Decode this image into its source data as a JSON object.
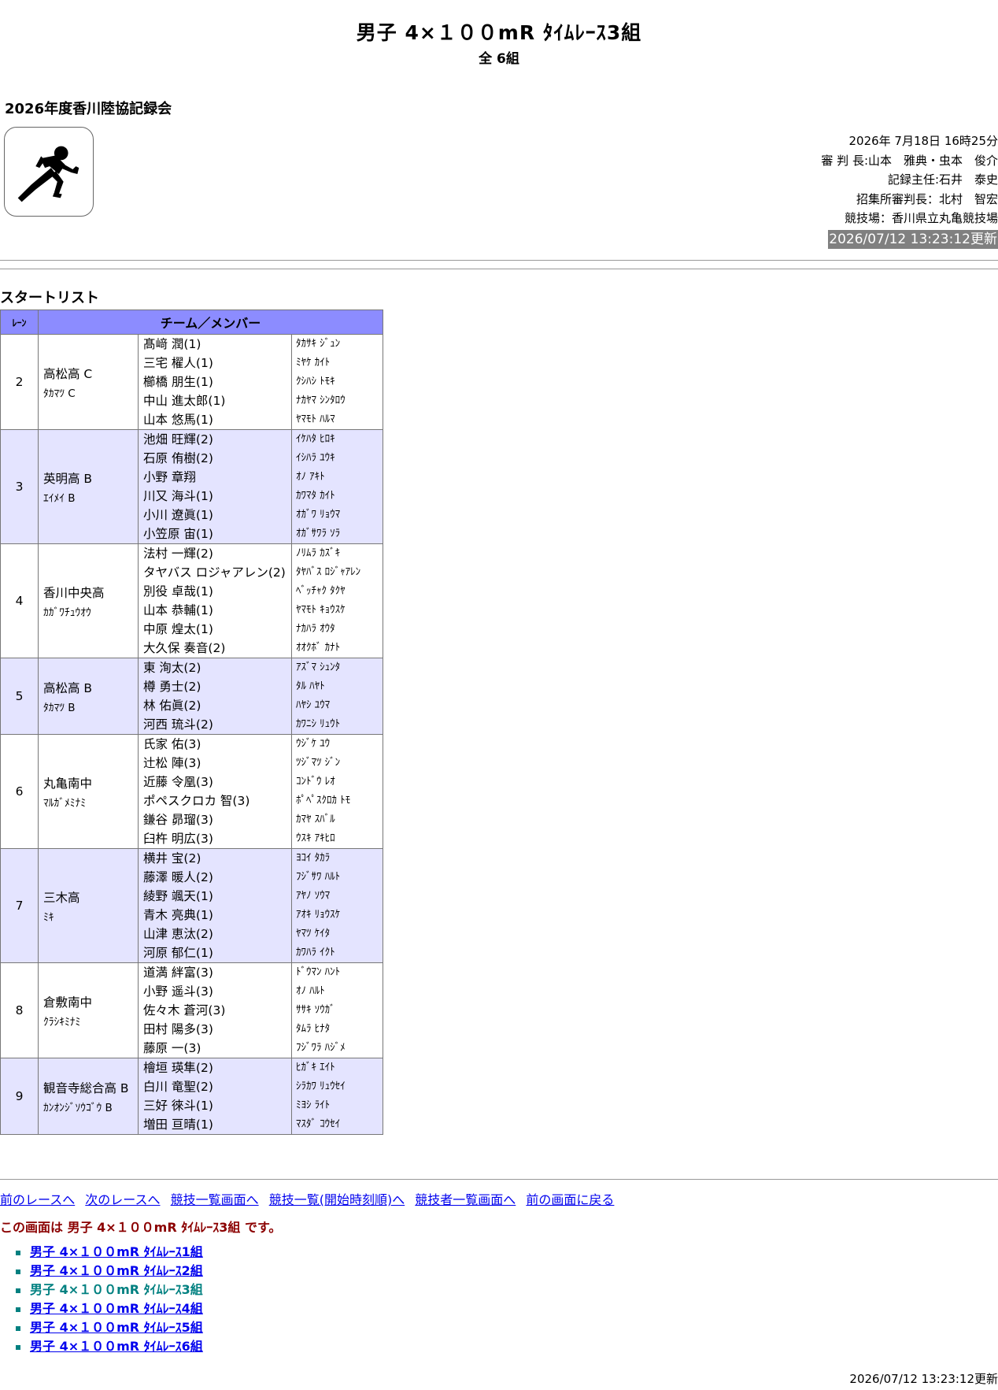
{
  "header": {
    "title": "男子 4×１００mR ﾀｲﾑﾚｰｽ3組",
    "subtitle": "全 6組",
    "meet_name": "2026年度香川陸協記録会",
    "logo_icon": "sprinter-icon"
  },
  "info": {
    "date": "2026年 7月18日 16時25分",
    "referee": "審 判 長:山本　雅典・虫本　俊介",
    "recorder": "記録主任:石井　泰史",
    "call_referee": "招集所審判長：北村　智宏",
    "venue": "競技場：香川県立丸亀競技場",
    "updated": "2026/07/12 13:23:12更新"
  },
  "section_title": "スタートリスト",
  "table": {
    "headers": {
      "lane": "ﾚｰﾝ",
      "team": "チーム／メンバー"
    },
    "rows": [
      {
        "lane": "2",
        "team": "高松高 C",
        "team_kana": "ﾀｶﾏﾂ C",
        "members": [
          "髙﨑 潤(1)",
          "三宅 櫂人(1)",
          "櫛橋 朋生(1)",
          "中山 進太郎(1)",
          "山本 悠馬(1)"
        ],
        "kanas": [
          "ﾀｶｻｷ ｼﾞｭﾝ",
          "ﾐﾔｹ ｶｲﾄ",
          "ｸｼﾊｼ ﾄﾓｷ",
          "ﾅｶﾔﾏ ｼﾝﾀﾛｳ",
          "ﾔﾏﾓﾄ ﾊﾙﾏ"
        ]
      },
      {
        "lane": "3",
        "team": "英明高 B",
        "team_kana": "ｴｲﾒｲ B",
        "members": [
          "池畑 旺輝(2)",
          "石原 侑樹(2)",
          "小野 章翔",
          "川又 海斗(1)",
          "小川 遼眞(1)",
          "小笠原 宙(1)"
        ],
        "kanas": [
          "ｲｹﾊﾀ ﾋﾛｷ",
          "ｲｼﾊﾗ ﾕｳｷ",
          "ｵﾉ ｱｷﾄ",
          "ｶﾜﾏﾀ ｶｲﾄ",
          "ｵｶﾞﾜ ﾘｮｳﾏ",
          "ｵｶﾞｻﾜﾗ ｿﾗ"
        ]
      },
      {
        "lane": "4",
        "team": "香川中央高",
        "team_kana": "ｶｶﾞﾜﾁｭｳｵｳ",
        "members": [
          "法村 一輝(2)",
          "タヤバス ロジャアレン(2)",
          "別役 卓哉(1)",
          "山本 恭輔(1)",
          "中原 煌太(1)",
          "大久保 奏音(2)"
        ],
        "kanas": [
          "ﾉﾘﾑﾗ ｶｽﾞｷ",
          "ﾀﾔﾊﾞｽ ﾛｼﾞｬｱﾚﾝ",
          "ﾍﾞｯﾁｬｸ ﾀｸﾔ",
          "ﾔﾏﾓﾄ ｷｮｳｽｹ",
          "ﾅｶﾊﾗ ｵｳﾀ",
          "ｵｵｸﾎﾞ ｶﾅﾄ"
        ]
      },
      {
        "lane": "5",
        "team": "高松高 B",
        "team_kana": "ﾀｶﾏﾂ B",
        "members": [
          "東 洵太(2)",
          "樽 勇士(2)",
          "林 佑眞(2)",
          "河西 琉斗(2)"
        ],
        "kanas": [
          "ｱｽﾞﾏ ｼｭﾝﾀ",
          "ﾀﾙ ﾊﾔﾄ",
          "ﾊﾔｼ ﾕｳﾏ",
          "ｶﾜﾆｼ ﾘｭｳﾄ"
        ]
      },
      {
        "lane": "6",
        "team": "丸亀南中",
        "team_kana": "ﾏﾙｶﾞﾒﾐﾅﾐ",
        "members": [
          "氏家 佑(3)",
          "辻松 陣(3)",
          "近藤 令凰(3)",
          "ポペスクロカ 智(3)",
          "鎌谷 昴瑠(3)",
          "臼杵 明広(3)"
        ],
        "kanas": [
          "ｳｼﾞｹ ﾕｳ",
          "ﾂｼﾞﾏﾂ ｼﾞﾝ",
          "ｺﾝﾄﾞｳ ﾚｵ",
          "ﾎﾟﾍﾟｽｸﾛｶ ﾄﾓ",
          "ｶﾏﾔ ｽﾊﾞﾙ",
          "ｳｽｷ ｱｷﾋﾛ"
        ]
      },
      {
        "lane": "7",
        "team": "三木高",
        "team_kana": "ﾐｷ",
        "members": [
          "横井 宝(2)",
          "藤澤 暖人(2)",
          "綾野 颯天(1)",
          "青木 亮典(1)",
          "山津 恵汰(2)",
          "河原 郁仁(1)"
        ],
        "kanas": [
          "ﾖｺｲ ﾀｶﾗ",
          "ﾌｼﾞｻﾜ ﾊﾙﾄ",
          "ｱﾔﾉ ｿｳﾏ",
          "ｱｵｷ ﾘｮｳｽｹ",
          "ﾔﾏﾂ ｹｲﾀ",
          "ｶﾜﾊﾗ ｲｸﾄ"
        ]
      },
      {
        "lane": "8",
        "team": "倉敷南中",
        "team_kana": "ｸﾗｼｷﾐﾅﾐ",
        "members": [
          "道満 絆富(3)",
          "小野 遥斗(3)",
          "佐々木 蒼河(3)",
          "田村 陽多(3)",
          "藤原 一(3)"
        ],
        "kanas": [
          "ﾄﾞｳﾏﾝ ﾊﾝﾄ",
          "ｵﾉ ﾊﾙﾄ",
          "ｻｻｷ ｿｳｶﾞ",
          "ﾀﾑﾗ ﾋﾅﾀ",
          "ﾌｼﾞﾜﾗ ﾊｼﾞﾒ"
        ]
      },
      {
        "lane": "9",
        "team": "観音寺総合高 B",
        "team_kana": "ｶﾝｵﾝｼﾞｿｳｺﾞｳ B",
        "members": [
          "檜垣 瑛隼(2)",
          "白川 竜聖(2)",
          "三好 徠斗(1)",
          "増田 亘晴(1)"
        ],
        "kanas": [
          "ﾋｶﾞｷ ｴｲﾄ",
          "ｼﾗｶﾜ ﾘｭｳｾｲ",
          "ﾐﾖｼ ﾗｲﾄ",
          "ﾏｽﾀﾞ ｺｳｾｲ"
        ]
      }
    ]
  },
  "nav": {
    "prev_race": "前のレースへ",
    "next_race": "次のレースへ",
    "event_list": "競技一覧画面へ",
    "event_list_time": "競技一覧(開始時刻順)へ",
    "athlete_list": "競技者一覧画面へ",
    "back": "前の画面に戻る"
  },
  "current_screen": "この画面は 男子 4×１００mR ﾀｲﾑﾚｰｽ3組 です。",
  "races": [
    "男子 4×１００mR ﾀｲﾑﾚｰｽ1組",
    "男子 4×１００mR ﾀｲﾑﾚｰｽ2組",
    "男子 4×１００mR ﾀｲﾑﾚｰｽ3組",
    "男子 4×１００mR ﾀｲﾑﾚｰｽ4組",
    "男子 4×１００mR ﾀｲﾑﾚｰｽ5組",
    "男子 4×１００mR ﾀｲﾑﾚｰｽ6組"
  ],
  "current_race_index": 2,
  "footer_updated": "2026/07/12 13:23:12更新"
}
